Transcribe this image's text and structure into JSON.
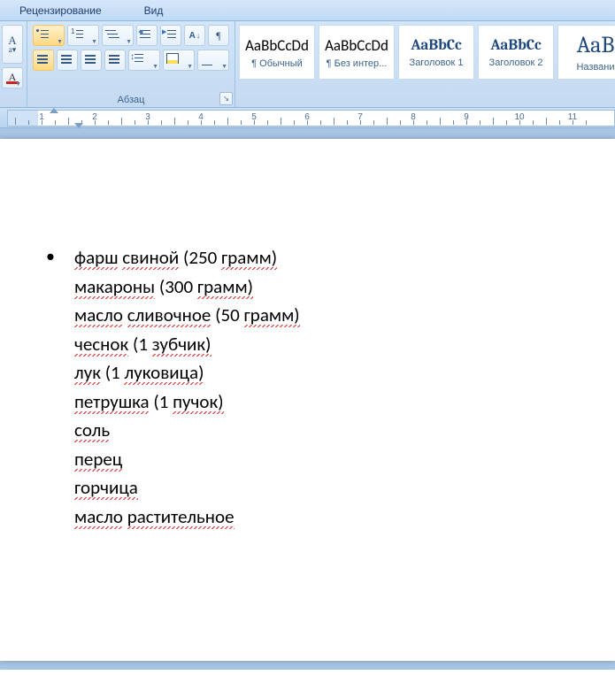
{
  "menu": {
    "review": "Рецензирование",
    "view": "Вид"
  },
  "ribbon": {
    "paragraph_label": "Абзац",
    "sort_text": "А",
    "pilcrow": "¶"
  },
  "styles": [
    {
      "preview": "AaBbCcDd",
      "label": "¶ Обычный",
      "class": ""
    },
    {
      "preview": "AaBbCcDd",
      "label": "¶ Без интер...",
      "class": ""
    },
    {
      "preview": "AaBbCc",
      "label": "Заголовок 1",
      "class": "blue"
    },
    {
      "preview": "AaBbCc",
      "label": "Заголовок 2",
      "class": "blue"
    },
    {
      "preview": "AaB",
      "label": "Названи",
      "class": "big"
    }
  ],
  "ruler": {
    "numbers": [
      "1",
      "2",
      "3",
      "4",
      "5",
      "6",
      "7",
      "8",
      "9",
      "10",
      "11"
    ],
    "pitch": 60,
    "left_margin": 34,
    "first_line_indent": 52,
    "hanging_indent": 80
  },
  "document": {
    "items": [
      "фарш свиной (250 грамм)",
      "макароны (300 грамм)",
      "масло сливочное (50 грамм)",
      "чеснок (1 зубчик)",
      "лук (1 луковица)",
      "петрушка (1 пучок)",
      "соль",
      "перец",
      "горчица",
      "масло растительное"
    ]
  }
}
